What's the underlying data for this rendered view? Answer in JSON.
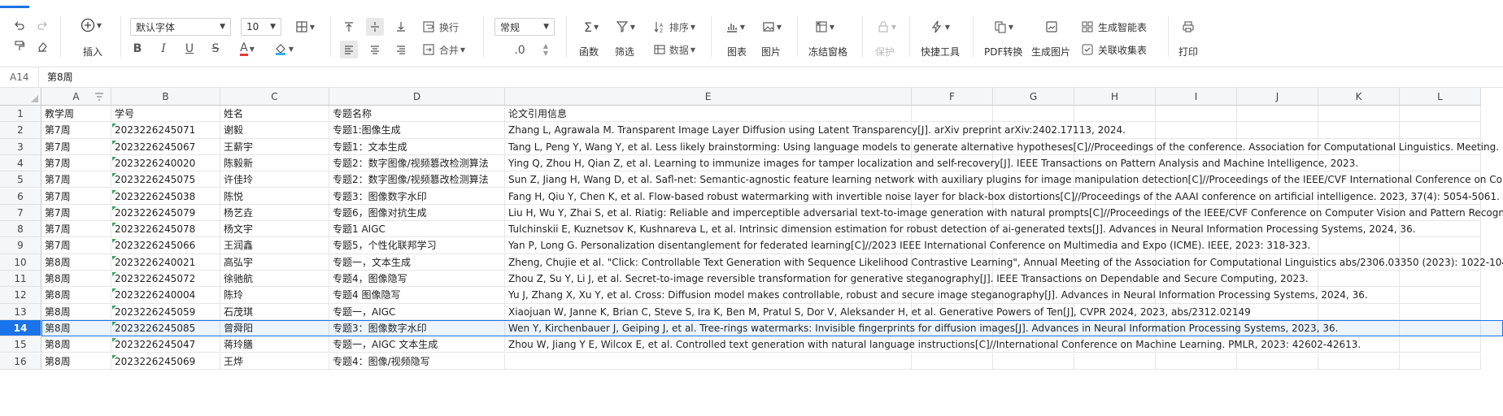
{
  "toolbar": {
    "insert_label": "插入",
    "font_name": "默认字体",
    "font_size": "10",
    "wrap_label": "换行",
    "merge_label": "合并",
    "number_format": "常规",
    "decimal_label": ".0",
    "function_label": "函数",
    "filter_label": "筛选",
    "sort_label": "排序",
    "data_label": "数据",
    "chart_label": "图表",
    "picture_label": "图片",
    "freeze_label": "冻结窗格",
    "protect_label": "保护",
    "quick_tools_label": "快捷工具",
    "pdf_convert_label": "PDF转换",
    "generate_image_label": "生成图片",
    "smart_table_label": "生成智能表",
    "link_collect_label": "关联收集表",
    "print_label": "打印"
  },
  "formula_bar": {
    "cell_ref": "A14",
    "value": "第8周"
  },
  "columns": [
    "A",
    "B",
    "C",
    "D",
    "E",
    "F",
    "G",
    "H",
    "I",
    "J",
    "K",
    "L"
  ],
  "rows": [
    {
      "num": "1",
      "a": "教学周",
      "b": "学号",
      "c": "姓名",
      "d": "专题名称",
      "e": "论文引用信息"
    },
    {
      "num": "2",
      "a": "第7周",
      "b": "2023226245071",
      "c": "谢毅",
      "d": "专题1:图像生成",
      "e": "Zhang L, Agrawala M. Transparent Image Layer Diffusion using Latent Transparency[J]. arXiv preprint arXiv:2402.17113, 2024."
    },
    {
      "num": "3",
      "a": "第7周",
      "b": "2023226245067",
      "c": "王薪宇",
      "d": "专题1：文本生成",
      "e": "Tang L, Peng Y, Wang Y, et al. Less likely brainstorming: Using language models to generate alternative hypotheses[C]//Proceedings of the conference. Association for Computational Linguistics. Meeting. M"
    },
    {
      "num": "4",
      "a": "第7周",
      "b": "2023226240020",
      "c": "陈毅新",
      "d": "专题2：数字图像/视频篡改检测算法",
      "e": "Ying Q, Zhou H, Qian Z, et al. Learning to immunize images for tamper localization and self-recovery[J]. IEEE Transactions on Pattern Analysis and Machine Intelligence, 2023."
    },
    {
      "num": "5",
      "a": "第7周",
      "b": "2023226245075",
      "c": "许佳玲",
      "d": "专题2：数字图像/视频篡改检测算法",
      "e": "Sun Z, Jiang H, Wang D, et al. Safl-net: Semantic-agnostic feature learning network with auxiliary plugins for image manipulation detection[C]//Proceedings of the IEEE/CVF International Conference on Co"
    },
    {
      "num": "6",
      "a": "第7周",
      "b": "2023226245038",
      "c": "陈悦",
      "d": "专题3：图像数字水印",
      "e": "Fang H, Qiu Y, Chen K, et al. Flow-based robust watermarking with invertible noise layer for black-box distortions[C]//Proceedings of the AAAI conference on artificial intelligence. 2023, 37(4): 5054-5061."
    },
    {
      "num": "7",
      "a": "第7周",
      "b": "2023226245079",
      "c": "杨艺垚",
      "d": "专题6，图像对抗生成",
      "e": "Liu H, Wu Y, Zhai S, et al. Riatig: Reliable and imperceptible adversarial text-to-image generation with natural prompts[C]//Proceedings of the IEEE/CVF Conference on Computer Vision and Pattern Recogni"
    },
    {
      "num": "8",
      "a": "第7周",
      "b": "2023226245078",
      "c": "杨文宇",
      "d": "专题1 AIGC",
      "e": "Tulchinskii E, Kuznetsov K, Kushnareva L, et al. Intrinsic dimension estimation for robust detection of ai-generated texts[J]. Advances in Neural Information Processing Systems, 2024, 36."
    },
    {
      "num": "9",
      "a": "第7周",
      "b": "2023226245066",
      "c": "王润鑫",
      "d": "专题5，个性化联邦学习",
      "e": "Yan P, Long G. Personalization disentanglement for federated learning[C]//2023 IEEE International Conference on Multimedia and Expo (ICME). IEEE, 2023: 318-323."
    },
    {
      "num": "10",
      "a": "第8周",
      "b": "2023226240021",
      "c": "高弘宇",
      "d": "专题一，文本生成",
      "e": "Zheng, Chujie et al. \"Click: Controllable Text Generation with Sequence Likelihood Contrastive  Learning\", Annual Meeting of the Association for Computational Linguistics abs/2306.03350 (2023): 1022-104"
    },
    {
      "num": "11",
      "a": "第8周",
      "b": "2023226245072",
      "c": "徐驰航",
      "d": "专题4，图像隐写",
      "e": "Zhou Z, Su Y, Li J, et al. Secret-to-image reversible transformation for generative steganography[J]. IEEE Transactions on Dependable and Secure Computing, 2023."
    },
    {
      "num": "12",
      "a": "第8周",
      "b": "2023226240004",
      "c": "陈玲",
      "d": "专题4 图像隐写",
      "e": "Yu J, Zhang X, Xu Y, et al. Cross: Diffusion model makes controllable, robust and secure image steganography[J]. Advances in Neural Information Processing Systems, 2024, 36."
    },
    {
      "num": "13",
      "a": "第8周",
      "b": "2023226245059",
      "c": "石茂琪",
      "d": "专题一，AIGC",
      "e": "Xiaojuan W, Janne K, Brian C, Steve S, Ira K, Ben M, Pratul S, Dor V, Aleksander H, et al. Generative Powers of Ten[J], CVPR 2024, 2023, abs/2312.02149"
    },
    {
      "num": "14",
      "a": "第8周",
      "b": "2023226245085",
      "c": "曾舜阳",
      "d": "专题3：图像数字水印",
      "e": "Wen Y, Kirchenbauer J, Geiping J, et al. Tree-rings watermarks: Invisible fingerprints for diffusion images[J]. Advances in Neural Information Processing Systems, 2023, 36."
    },
    {
      "num": "15",
      "a": "第8周",
      "b": "2023226245047",
      "c": "蒋玲膳",
      "d": "专题一，AIGC 文本生成",
      "e": "Zhou W, Jiang Y E, Wilcox E, et al. Controlled text generation with natural language instructions[C]//International Conference on Machine Learning. PMLR, 2023: 42602-42613."
    },
    {
      "num": "16",
      "a": "第8周",
      "b": "2023226245069",
      "c": "王烨",
      "d": "专题4：图像/视频隐写",
      "e": ""
    }
  ],
  "selected_row": "14",
  "colors": {
    "accent": "#1a73e8",
    "header_bg": "#f5f6f7",
    "text_marker": "#35a35a"
  }
}
